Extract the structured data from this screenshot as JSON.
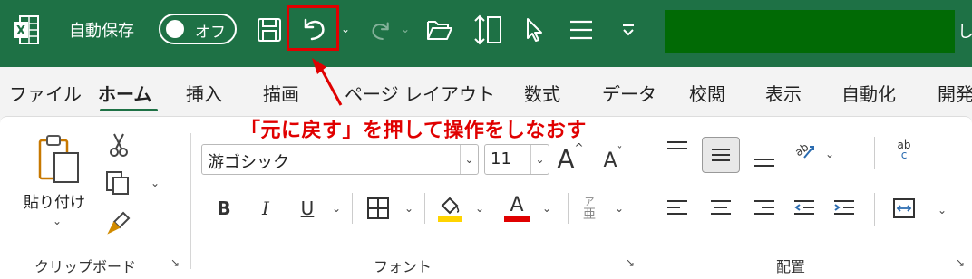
{
  "title_bar": {
    "autosave_label": "自動保存",
    "autosave_state": "オフ",
    "buttons": [
      "save-icon",
      "undo-icon",
      "redo-icon",
      "open-folder-icon",
      "touch-mode-icon",
      "pointer-icon",
      "list-icon",
      "customize-icon"
    ],
    "title_tail": "し",
    "bg_color": "#1e7145",
    "highlight_color": "#e00000"
  },
  "tabs": [
    "ファイル",
    "ホーム",
    "挿入",
    "描画",
    "ページ レイアウト",
    "数式",
    "データ",
    "校閲",
    "表示",
    "自動化",
    "開発"
  ],
  "active_tab": "ホーム",
  "annotation": "「元に戻す」を押して操作をしなおす",
  "clipboard": {
    "paste_label": "貼り付け",
    "group_label": "クリップボード"
  },
  "font": {
    "font_name": "游ゴシック",
    "font_size": "11",
    "bold_label": "B",
    "italic_label": "I",
    "underline_label": "U",
    "font_color_label": "A",
    "grow_label": "A",
    "shrink_label": "A",
    "phonetic_top": "ア",
    "phonetic_bottom": "亜",
    "group_label": "フォント",
    "fill_color": "#ffd400",
    "font_color": "#e00000"
  },
  "alignment": {
    "group_label": "配置",
    "wrap_label": "ab",
    "wrap_label2": "c"
  }
}
